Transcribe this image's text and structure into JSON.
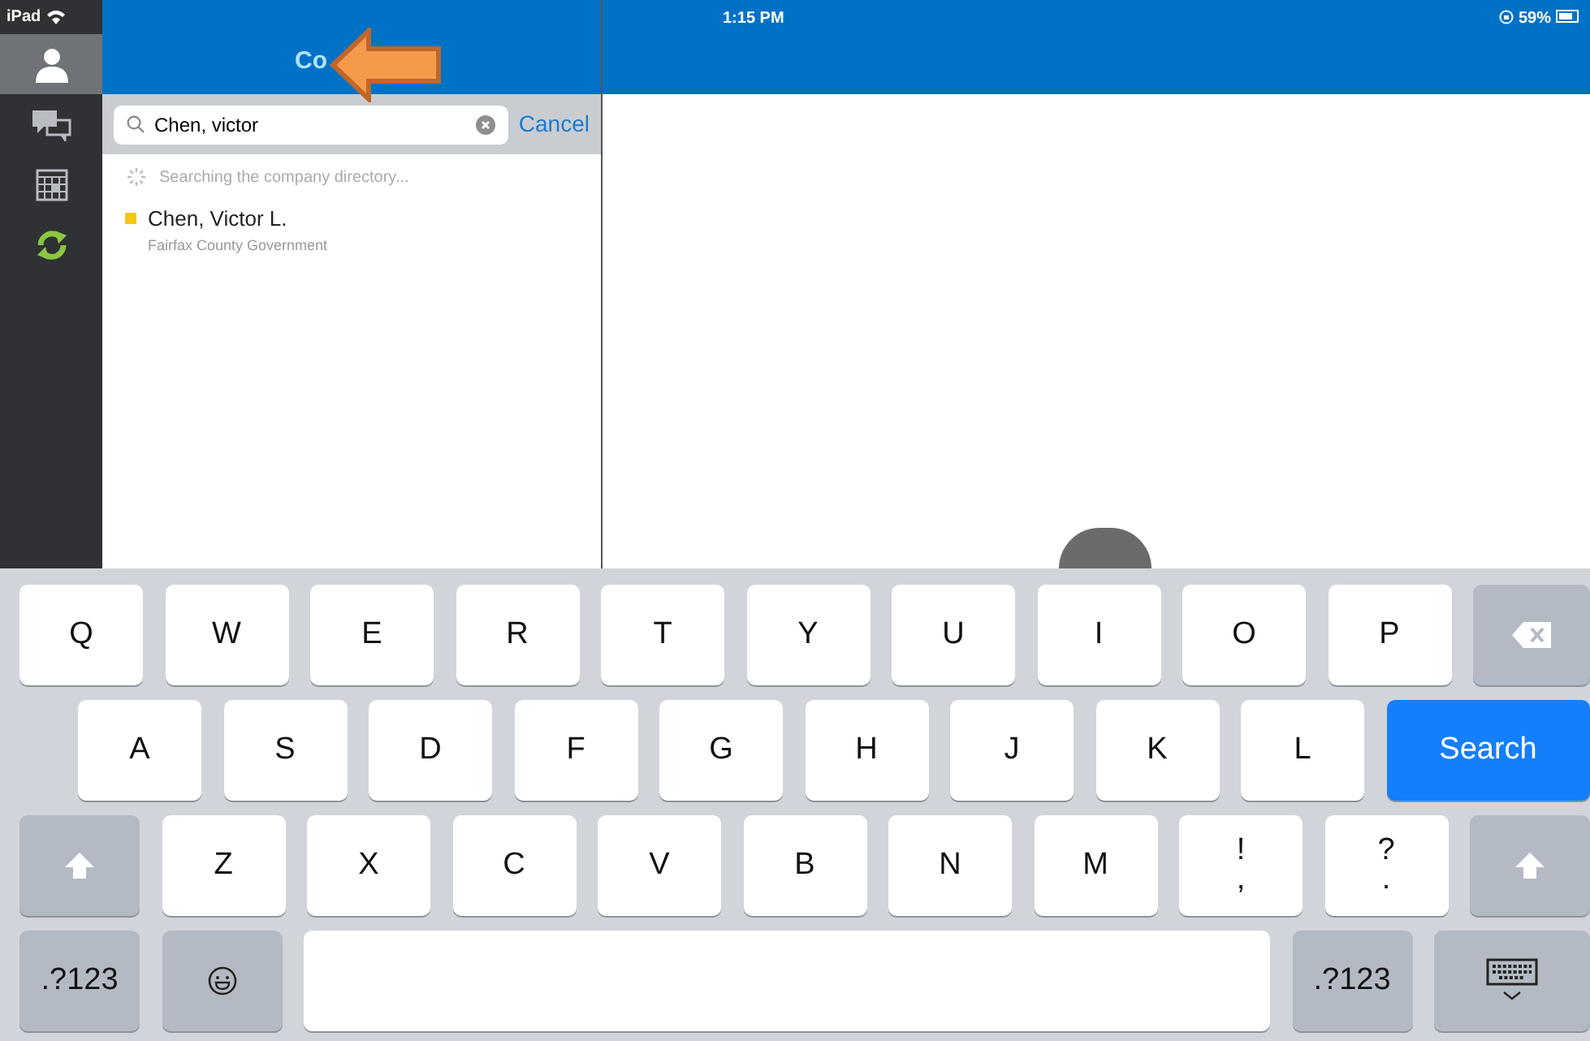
{
  "status_bar": {
    "device": "iPad",
    "time": "1:15 PM",
    "battery": "59%"
  },
  "sidebar": {
    "items": [
      {
        "kind": "person",
        "selected": true
      },
      {
        "kind": "chat",
        "selected": false
      },
      {
        "kind": "calendar",
        "selected": false
      },
      {
        "kind": "sync",
        "selected": false
      }
    ]
  },
  "panel": {
    "title": "Co",
    "search": {
      "value": "Chen, victor",
      "cancel": "Cancel"
    },
    "status": "Searching the company directory...",
    "results": [
      {
        "name": "Chen, Victor L.",
        "org": "Fairfax County Government",
        "color": "#f5c518"
      }
    ]
  },
  "keyboard": {
    "rows": [
      {
        "keys": [
          {
            "kind": "letter",
            "label": "Q"
          },
          {
            "kind": "letter",
            "label": "W"
          },
          {
            "kind": "letter",
            "label": "E"
          },
          {
            "kind": "letter",
            "label": "R"
          },
          {
            "kind": "letter",
            "label": "T"
          },
          {
            "kind": "letter",
            "label": "Y"
          },
          {
            "kind": "letter",
            "label": "U"
          },
          {
            "kind": "letter",
            "label": "I"
          },
          {
            "kind": "letter",
            "label": "O"
          },
          {
            "kind": "letter",
            "label": "P"
          },
          {
            "kind": "backspace"
          }
        ]
      },
      {
        "keys": [
          {
            "kind": "letter",
            "label": "A"
          },
          {
            "kind": "letter",
            "label": "S"
          },
          {
            "kind": "letter",
            "label": "D"
          },
          {
            "kind": "letter",
            "label": "F"
          },
          {
            "kind": "letter",
            "label": "G"
          },
          {
            "kind": "letter",
            "label": "H"
          },
          {
            "kind": "letter",
            "label": "J"
          },
          {
            "kind": "letter",
            "label": "K"
          },
          {
            "kind": "letter",
            "label": "L"
          },
          {
            "kind": "search",
            "label": "Search"
          }
        ]
      },
      {
        "keys": [
          {
            "kind": "shift"
          },
          {
            "kind": "letter",
            "label": "Z"
          },
          {
            "kind": "letter",
            "label": "X"
          },
          {
            "kind": "letter",
            "label": "C"
          },
          {
            "kind": "letter",
            "label": "V"
          },
          {
            "kind": "letter",
            "label": "B"
          },
          {
            "kind": "letter",
            "label": "N"
          },
          {
            "kind": "letter",
            "label": "M"
          },
          {
            "kind": "symbol",
            "top": "!",
            "bottom": ","
          },
          {
            "kind": "symbol",
            "top": "?",
            "bottom": "."
          },
          {
            "kind": "shift"
          }
        ]
      },
      {
        "keys": [
          {
            "kind": "mode",
            "label": ".?123"
          },
          {
            "kind": "emoji"
          },
          {
            "kind": "space"
          },
          {
            "kind": "mode",
            "label": ".?123"
          },
          {
            "kind": "dismiss"
          }
        ]
      }
    ]
  }
}
